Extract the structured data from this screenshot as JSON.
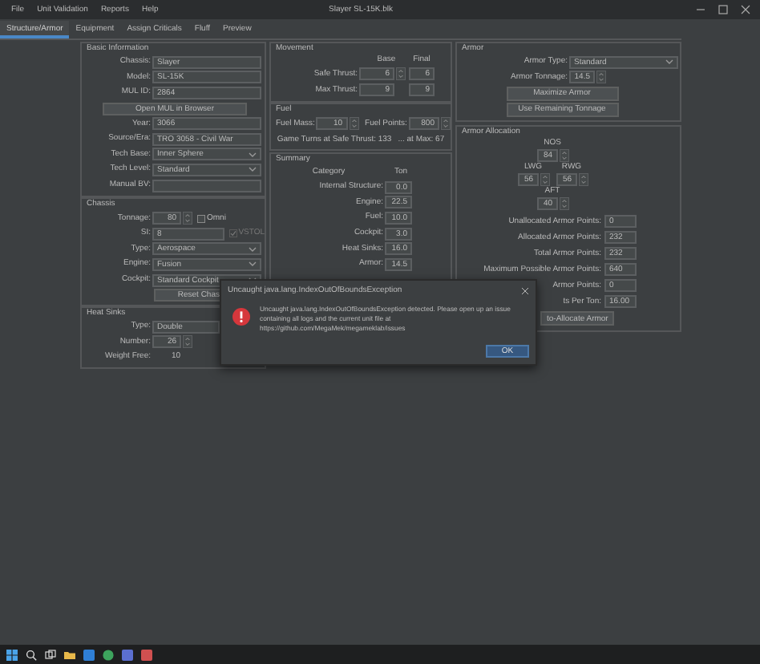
{
  "menu": [
    "File",
    "Unit Validation",
    "Reports",
    "Help"
  ],
  "window": {
    "title": "Slayer SL-15K.blk"
  },
  "tabs": [
    {
      "label": "Structure/Armor",
      "selected": true
    },
    {
      "label": "Equipment",
      "selected": false
    },
    {
      "label": "Assign Criticals",
      "selected": false
    },
    {
      "label": "Fluff",
      "selected": false
    },
    {
      "label": "Preview",
      "selected": false
    }
  ],
  "basic_information": {
    "title": "Basic Information",
    "rows": [
      {
        "kind": "text",
        "label": "Chassis:",
        "value": "Slayer"
      },
      {
        "kind": "text",
        "label": "Model:",
        "value": "SL-15K"
      },
      {
        "kind": "text",
        "label": "MUL ID:",
        "value": "2864"
      },
      {
        "kind": "button",
        "label": "Open MUL in Browser"
      },
      {
        "kind": "text",
        "label": "Year:",
        "value": "3066"
      },
      {
        "kind": "text",
        "label": "Source/Era:",
        "value": "TRO 3058 - Civil War"
      },
      {
        "kind": "dropdown",
        "label": "Tech Base:",
        "value": "Inner Sphere"
      },
      {
        "kind": "dropdown",
        "label": "Tech Level:",
        "value": "Standard"
      },
      {
        "kind": "text",
        "label": "Manual BV:"
      }
    ]
  },
  "chassis": {
    "title": "Chassis",
    "rows": [
      {
        "kind": "spinner",
        "label": "Tonnage:",
        "value": "80",
        "checkbox": {
          "label": "Omni",
          "checked": false,
          "disabled": false
        }
      },
      {
        "kind": "text",
        "label": "SI:",
        "value": "8",
        "checkbox": {
          "label": "VSTOL",
          "checked": true,
          "disabled": true
        }
      },
      {
        "kind": "dropdown",
        "label": "Type:",
        "value": "Aerospace"
      },
      {
        "kind": "dropdown",
        "label": "Engine:",
        "value": "Fusion"
      },
      {
        "kind": "dropdown",
        "label": "Cockpit:",
        "value": "Standard Cockpit"
      },
      {
        "kind": "button",
        "label": "Reset Chas"
      }
    ]
  },
  "heat_sinks": {
    "title": "Heat Sinks",
    "rows": [
      {
        "kind": "text",
        "label": "Type:",
        "value": "Double"
      },
      {
        "kind": "spinner",
        "label": "Number:",
        "value": "26"
      },
      {
        "kind": "readout",
        "label": "Weight Free:",
        "value": "10"
      }
    ]
  },
  "movement": {
    "title": "Movement",
    "columns": [
      "Base",
      "Final"
    ],
    "rows": [
      {
        "label": "Safe Thrust:",
        "kind": "spinner",
        "base": "6",
        "final": "6"
      },
      {
        "label": "Max Thrust:",
        "kind": "text",
        "base": "9",
        "final": "9"
      }
    ]
  },
  "fuel": {
    "title": "Fuel",
    "fields": [
      {
        "label": "Fuel Mass:",
        "value": "10"
      },
      {
        "label": "Fuel Points:",
        "value": "800"
      }
    ],
    "notes": [
      "Game Turns at Safe Thrust: 133",
      "... at Max: 67"
    ]
  },
  "summary": {
    "title": "Summary",
    "columns": [
      "Category",
      "Ton"
    ],
    "rows": [
      {
        "label": "Internal Structure:",
        "value": "0.0"
      },
      {
        "label": "Engine:",
        "value": "22.5"
      },
      {
        "label": "Fuel:",
        "value": "10.0"
      },
      {
        "label": "Cockpit:",
        "value": "3.0"
      },
      {
        "label": "Heat Sinks:",
        "value": "16.0"
      },
      {
        "label": "Armor:",
        "value": "14.5"
      }
    ]
  },
  "armor": {
    "title": "Armor",
    "armor_type": {
      "label": "Armor Type:",
      "value": "Standard"
    },
    "armor_tonnage": {
      "label": "Armor Tonnage:",
      "value": "14.5"
    },
    "buttons": [
      "Maximize Armor",
      "Use Remaining Tonnage"
    ]
  },
  "armor_allocation": {
    "title": "Armor Allocation",
    "locations": [
      {
        "label": "NOS",
        "value": "84"
      },
      {
        "label": "LWG",
        "value": "56"
      },
      {
        "label": "RWG",
        "value": "56"
      },
      {
        "label": "AFT",
        "value": "40"
      }
    ],
    "stats": [
      {
        "label": "Unallocated Armor Points:",
        "value": "0"
      },
      {
        "label": "Allocated Armor Points:",
        "value": "232"
      },
      {
        "label": "Total Armor Points:",
        "value": "232"
      },
      {
        "label": "Maximum Possible Armor Points:",
        "value": "640"
      },
      {
        "label": "Armor Points:",
        "value": "0"
      },
      {
        "label": "ts Per Ton:",
        "value": "16.00"
      }
    ],
    "button": "to-Allocate Armor"
  },
  "dialog": {
    "title": "Uncaught java.lang.IndexOutOfBoundsException",
    "message_lines": [
      "Uncaught java.lang.IndexOutOfBoundsException detected. Please open up an issue",
      "containing all logs and the current unit file at",
      "https://github.com/MegaMek/megameklab/issues"
    ],
    "button": "OK"
  }
}
